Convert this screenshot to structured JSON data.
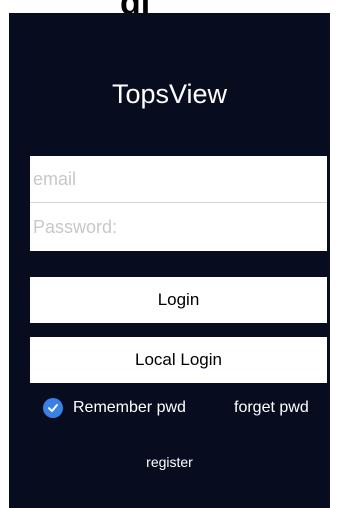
{
  "header_fragment": "gi",
  "app": {
    "title": "TopsView"
  },
  "form": {
    "email_placeholder": "email",
    "email_value": "",
    "password_placeholder": "Password:",
    "password_value": ""
  },
  "buttons": {
    "login_label": "Login",
    "local_login_label": "Local Login"
  },
  "options": {
    "remember_label": "Remember pwd",
    "remember_checked": true,
    "forget_label": "forget pwd"
  },
  "links": {
    "register_label": "register"
  },
  "colors": {
    "background": "#070d1f",
    "accent": "#3a80e6",
    "text": "#ffffff"
  },
  "icons": {
    "remember": "checkmark-circle-icon"
  }
}
